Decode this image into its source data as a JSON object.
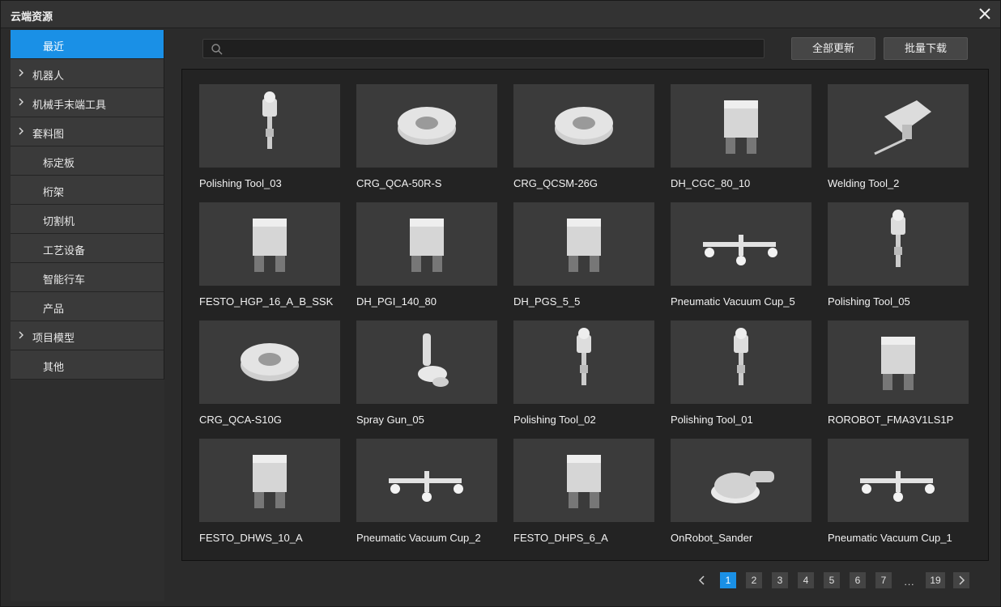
{
  "window": {
    "title": "云端资源"
  },
  "sidebar": {
    "items": [
      {
        "label": "最近",
        "chevron": false,
        "active": true
      },
      {
        "label": "机器人",
        "chevron": true
      },
      {
        "label": "机械手末端工具",
        "chevron": true
      },
      {
        "label": "套料图",
        "chevron": true
      },
      {
        "label": "标定板",
        "chevron": false
      },
      {
        "label": "桁架",
        "chevron": false
      },
      {
        "label": "切割机",
        "chevron": false
      },
      {
        "label": "工艺设备",
        "chevron": false
      },
      {
        "label": "智能行车",
        "chevron": false
      },
      {
        "label": "产品",
        "chevron": false
      },
      {
        "label": "项目模型",
        "chevron": true
      },
      {
        "label": "其他",
        "chevron": false
      }
    ]
  },
  "search": {
    "placeholder": "",
    "value": ""
  },
  "toolbar": {
    "update_all_label": "全部更新",
    "batch_download_label": "批量下载"
  },
  "items": [
    {
      "name": "Polishing Tool_03",
      "icon": "polishing-tool-icon"
    },
    {
      "name": "CRG_QCA-50R-S",
      "icon": "tool-changer-icon"
    },
    {
      "name": "CRG_QCSM-26G",
      "icon": "tool-changer-icon"
    },
    {
      "name": "DH_CGC_80_10",
      "icon": "gripper-icon"
    },
    {
      "name": "Welding Tool_2",
      "icon": "welding-tool-icon"
    },
    {
      "name": "FESTO_HGP_16_A_B_SSK",
      "icon": "gripper-icon"
    },
    {
      "name": "DH_PGI_140_80",
      "icon": "gripper-icon"
    },
    {
      "name": "DH_PGS_5_5",
      "icon": "gripper-icon"
    },
    {
      "name": "Pneumatic Vacuum Cup_5",
      "icon": "vacuum-cup-icon"
    },
    {
      "name": "Polishing Tool_05",
      "icon": "polishing-tool-icon"
    },
    {
      "name": "CRG_QCA-S10G",
      "icon": "tool-changer-icon"
    },
    {
      "name": "Spray Gun_05",
      "icon": "spray-gun-icon"
    },
    {
      "name": "Polishing Tool_02",
      "icon": "polishing-tool-icon"
    },
    {
      "name": "Polishing Tool_01",
      "icon": "polishing-tool-icon"
    },
    {
      "name": "ROROBOT_FMA3V1LS1P",
      "icon": "gripper-icon"
    },
    {
      "name": "FESTO_DHWS_10_A",
      "icon": "gripper-icon"
    },
    {
      "name": "Pneumatic Vacuum Cup_2",
      "icon": "vacuum-cup-icon"
    },
    {
      "name": "FESTO_DHPS_6_A",
      "icon": "gripper-icon"
    },
    {
      "name": "OnRobot_Sander",
      "icon": "sander-icon"
    },
    {
      "name": "Pneumatic Vacuum Cup_1",
      "icon": "vacuum-cup-icon"
    }
  ],
  "pagination": {
    "pages": [
      "1",
      "2",
      "3",
      "4",
      "5",
      "6",
      "7"
    ],
    "ellipsis": "...",
    "last": "19",
    "current": "1"
  },
  "colors": {
    "accent": "#1a90e6",
    "background": "#2b2b2b",
    "card": "#3b3b3b"
  }
}
